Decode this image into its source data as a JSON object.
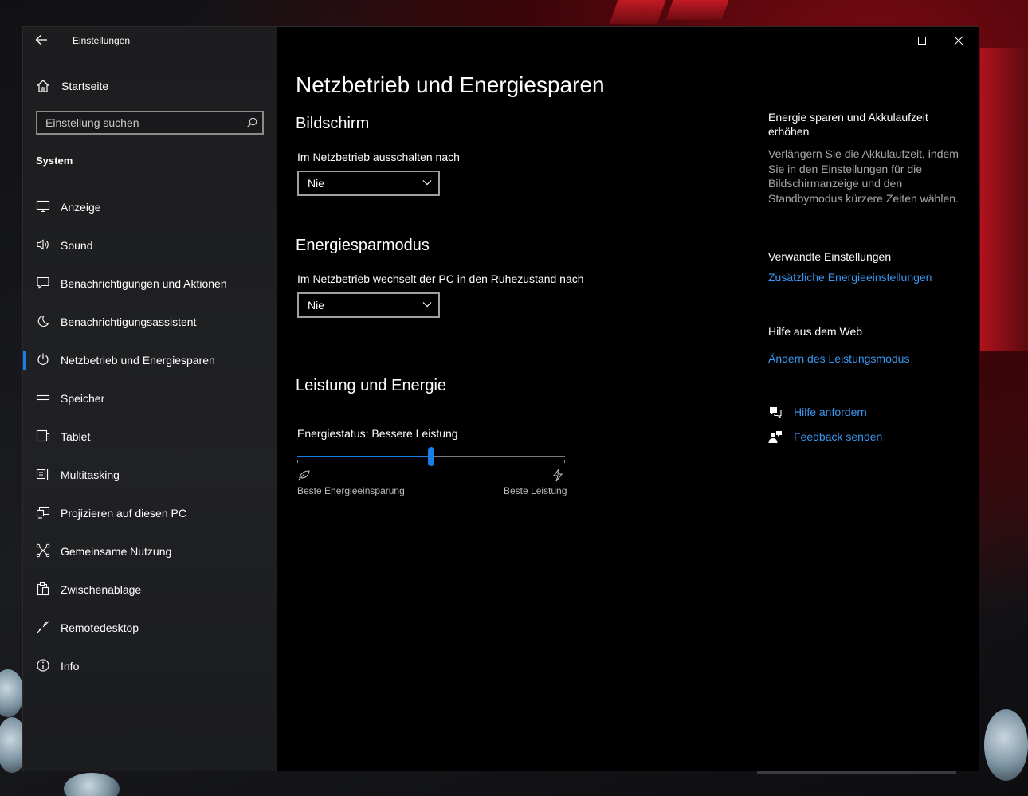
{
  "app": {
    "title": "Einstellungen"
  },
  "sidebar": {
    "home_label": "Startseite",
    "search_placeholder": "Einstellung suchen",
    "section_label": "System",
    "items": [
      {
        "label": "Anzeige",
        "icon": "monitor-icon"
      },
      {
        "label": "Sound",
        "icon": "speaker-icon"
      },
      {
        "label": "Benachrichtigungen und Aktionen",
        "icon": "notification-icon"
      },
      {
        "label": "Benachrichtigungsassistent",
        "icon": "moon-icon"
      },
      {
        "label": "Netzbetrieb und Energiesparen",
        "icon": "power-icon",
        "active": true
      },
      {
        "label": "Speicher",
        "icon": "storage-icon"
      },
      {
        "label": "Tablet",
        "icon": "tablet-icon"
      },
      {
        "label": "Multitasking",
        "icon": "multitasking-icon"
      },
      {
        "label": "Projizieren auf diesen PC",
        "icon": "project-icon"
      },
      {
        "label": "Gemeinsame Nutzung",
        "icon": "share-icon"
      },
      {
        "label": "Zwischenablage",
        "icon": "clipboard-icon"
      },
      {
        "label": "Remotedesktop",
        "icon": "remote-desktop-icon"
      },
      {
        "label": "Info",
        "icon": "info-icon"
      }
    ]
  },
  "main": {
    "title": "Netzbetrieb und Energiesparen",
    "screen": {
      "heading": "Bildschirm",
      "label": "Im Netzbetrieb ausschalten nach",
      "value": "Nie"
    },
    "sleep": {
      "heading": "Energiesparmodus",
      "label": "Im Netzbetrieb wechselt der PC in den Ruhezustand nach",
      "value": "Nie"
    },
    "power": {
      "heading": "Leistung und Energie",
      "status_label": "Energiestatus: Bessere Leistung",
      "slider_fraction": 0.5,
      "left_caption": "Beste Energieeinsparung",
      "right_caption": "Beste Leistung"
    }
  },
  "aside": {
    "tip_heading": "Energie sparen und Akkulaufzeit erhöhen",
    "tip_text": "Verlängern Sie die Akkulaufzeit, indem Sie in den Einstellungen für die Bildschirmanzeige und den Standbymodus kürzere Zeiten wählen.",
    "related_heading": "Verwandte Einstellungen",
    "related_link": "Zusätzliche Energieeinstellungen",
    "web_heading": "Hilfe aus dem Web",
    "web_link": "Ändern des Leistungsmodus",
    "help_link": "Hilfe anfordern",
    "feedback_link": "Feedback senden"
  },
  "colors": {
    "accent": "#1a7ee6",
    "link": "#3a97f0",
    "background": "#000000"
  }
}
